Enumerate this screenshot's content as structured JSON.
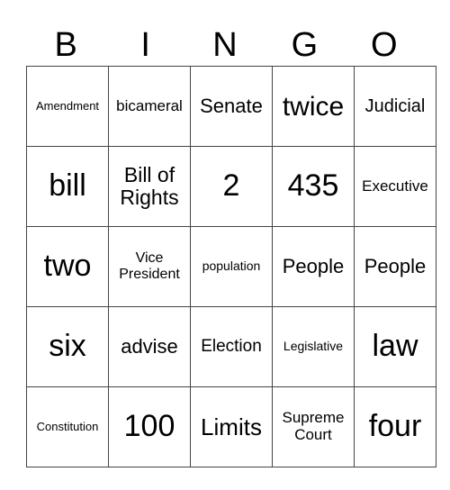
{
  "header": [
    "B",
    "I",
    "N",
    "G",
    "O"
  ],
  "cells": [
    [
      {
        "t": "Amendment",
        "s": 13
      },
      {
        "t": "bicameral",
        "s": 17
      },
      {
        "t": "Senate",
        "s": 22
      },
      {
        "t": "twice",
        "s": 30
      },
      {
        "t": "Judicial",
        "s": 20
      }
    ],
    [
      {
        "t": "bill",
        "s": 34
      },
      {
        "t": "Bill of Rights",
        "s": 23
      },
      {
        "t": "2",
        "s": 34
      },
      {
        "t": "435",
        "s": 34
      },
      {
        "t": "Executive",
        "s": 17
      }
    ],
    [
      {
        "t": "two",
        "s": 34
      },
      {
        "t": "Vice President",
        "s": 16
      },
      {
        "t": "population",
        "s": 14
      },
      {
        "t": "People",
        "s": 22
      },
      {
        "t": "People",
        "s": 22
      }
    ],
    [
      {
        "t": "six",
        "s": 34
      },
      {
        "t": "advise",
        "s": 22
      },
      {
        "t": "Election",
        "s": 19
      },
      {
        "t": "Legislative",
        "s": 14
      },
      {
        "t": "law",
        "s": 34
      }
    ],
    [
      {
        "t": "Constitution",
        "s": 13
      },
      {
        "t": "100",
        "s": 34
      },
      {
        "t": "Limits",
        "s": 26
      },
      {
        "t": "Supreme Court",
        "s": 17
      },
      {
        "t": "four",
        "s": 34
      }
    ]
  ]
}
